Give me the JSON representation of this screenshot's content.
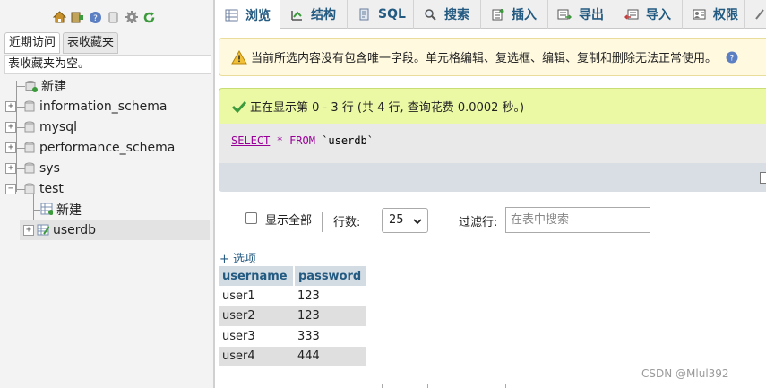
{
  "nav": {
    "icons": [
      "home-icon",
      "logout-icon",
      "help-icon",
      "docs-icon",
      "settings-icon",
      "reload-icon"
    ],
    "tabs": {
      "recent": "近期访问",
      "favorites": "表收藏夹"
    },
    "favorites_empty": "表收藏夹为空。",
    "tree": {
      "new_label": "新建",
      "databases": [
        "information_schema",
        "mysql",
        "performance_schema",
        "sys",
        "test"
      ],
      "test_children": {
        "new_label": "新建",
        "table": "userdb"
      }
    }
  },
  "tabs": [
    "浏览",
    "结构",
    "SQL",
    "搜索",
    "插入",
    "导出",
    "导入",
    "权限"
  ],
  "notice": "当前所选内容没有包含唯一字段。单元格编辑、复选框、编辑、复制和删除无法正常使用。",
  "success": "正在显示第 0 - 3 行 (共 4 行, 查询花费 0.0002 秒。)",
  "sql": {
    "select": "SELECT",
    "star": "*",
    "from": "FROM",
    "table": "`userdb`"
  },
  "controls": {
    "show_all": "显示全部",
    "rows_label": "行数:",
    "rows_value": "25",
    "filter_label": "过滤行:",
    "filter_placeholder": "在表中搜索"
  },
  "options_link": "+ 选项",
  "table": {
    "columns": [
      "username",
      "password"
    ],
    "rows": [
      [
        "user1",
        "123"
      ],
      [
        "user2",
        "123"
      ],
      [
        "user3",
        "333"
      ],
      [
        "user4",
        "444"
      ]
    ]
  },
  "watermark": "CSDN @Mlul392",
  "colors": {
    "link": "#235a81",
    "notice_bg": "#fff9e0",
    "success_bg": "#ebf8a4",
    "header_bg": "#d3dce3"
  }
}
